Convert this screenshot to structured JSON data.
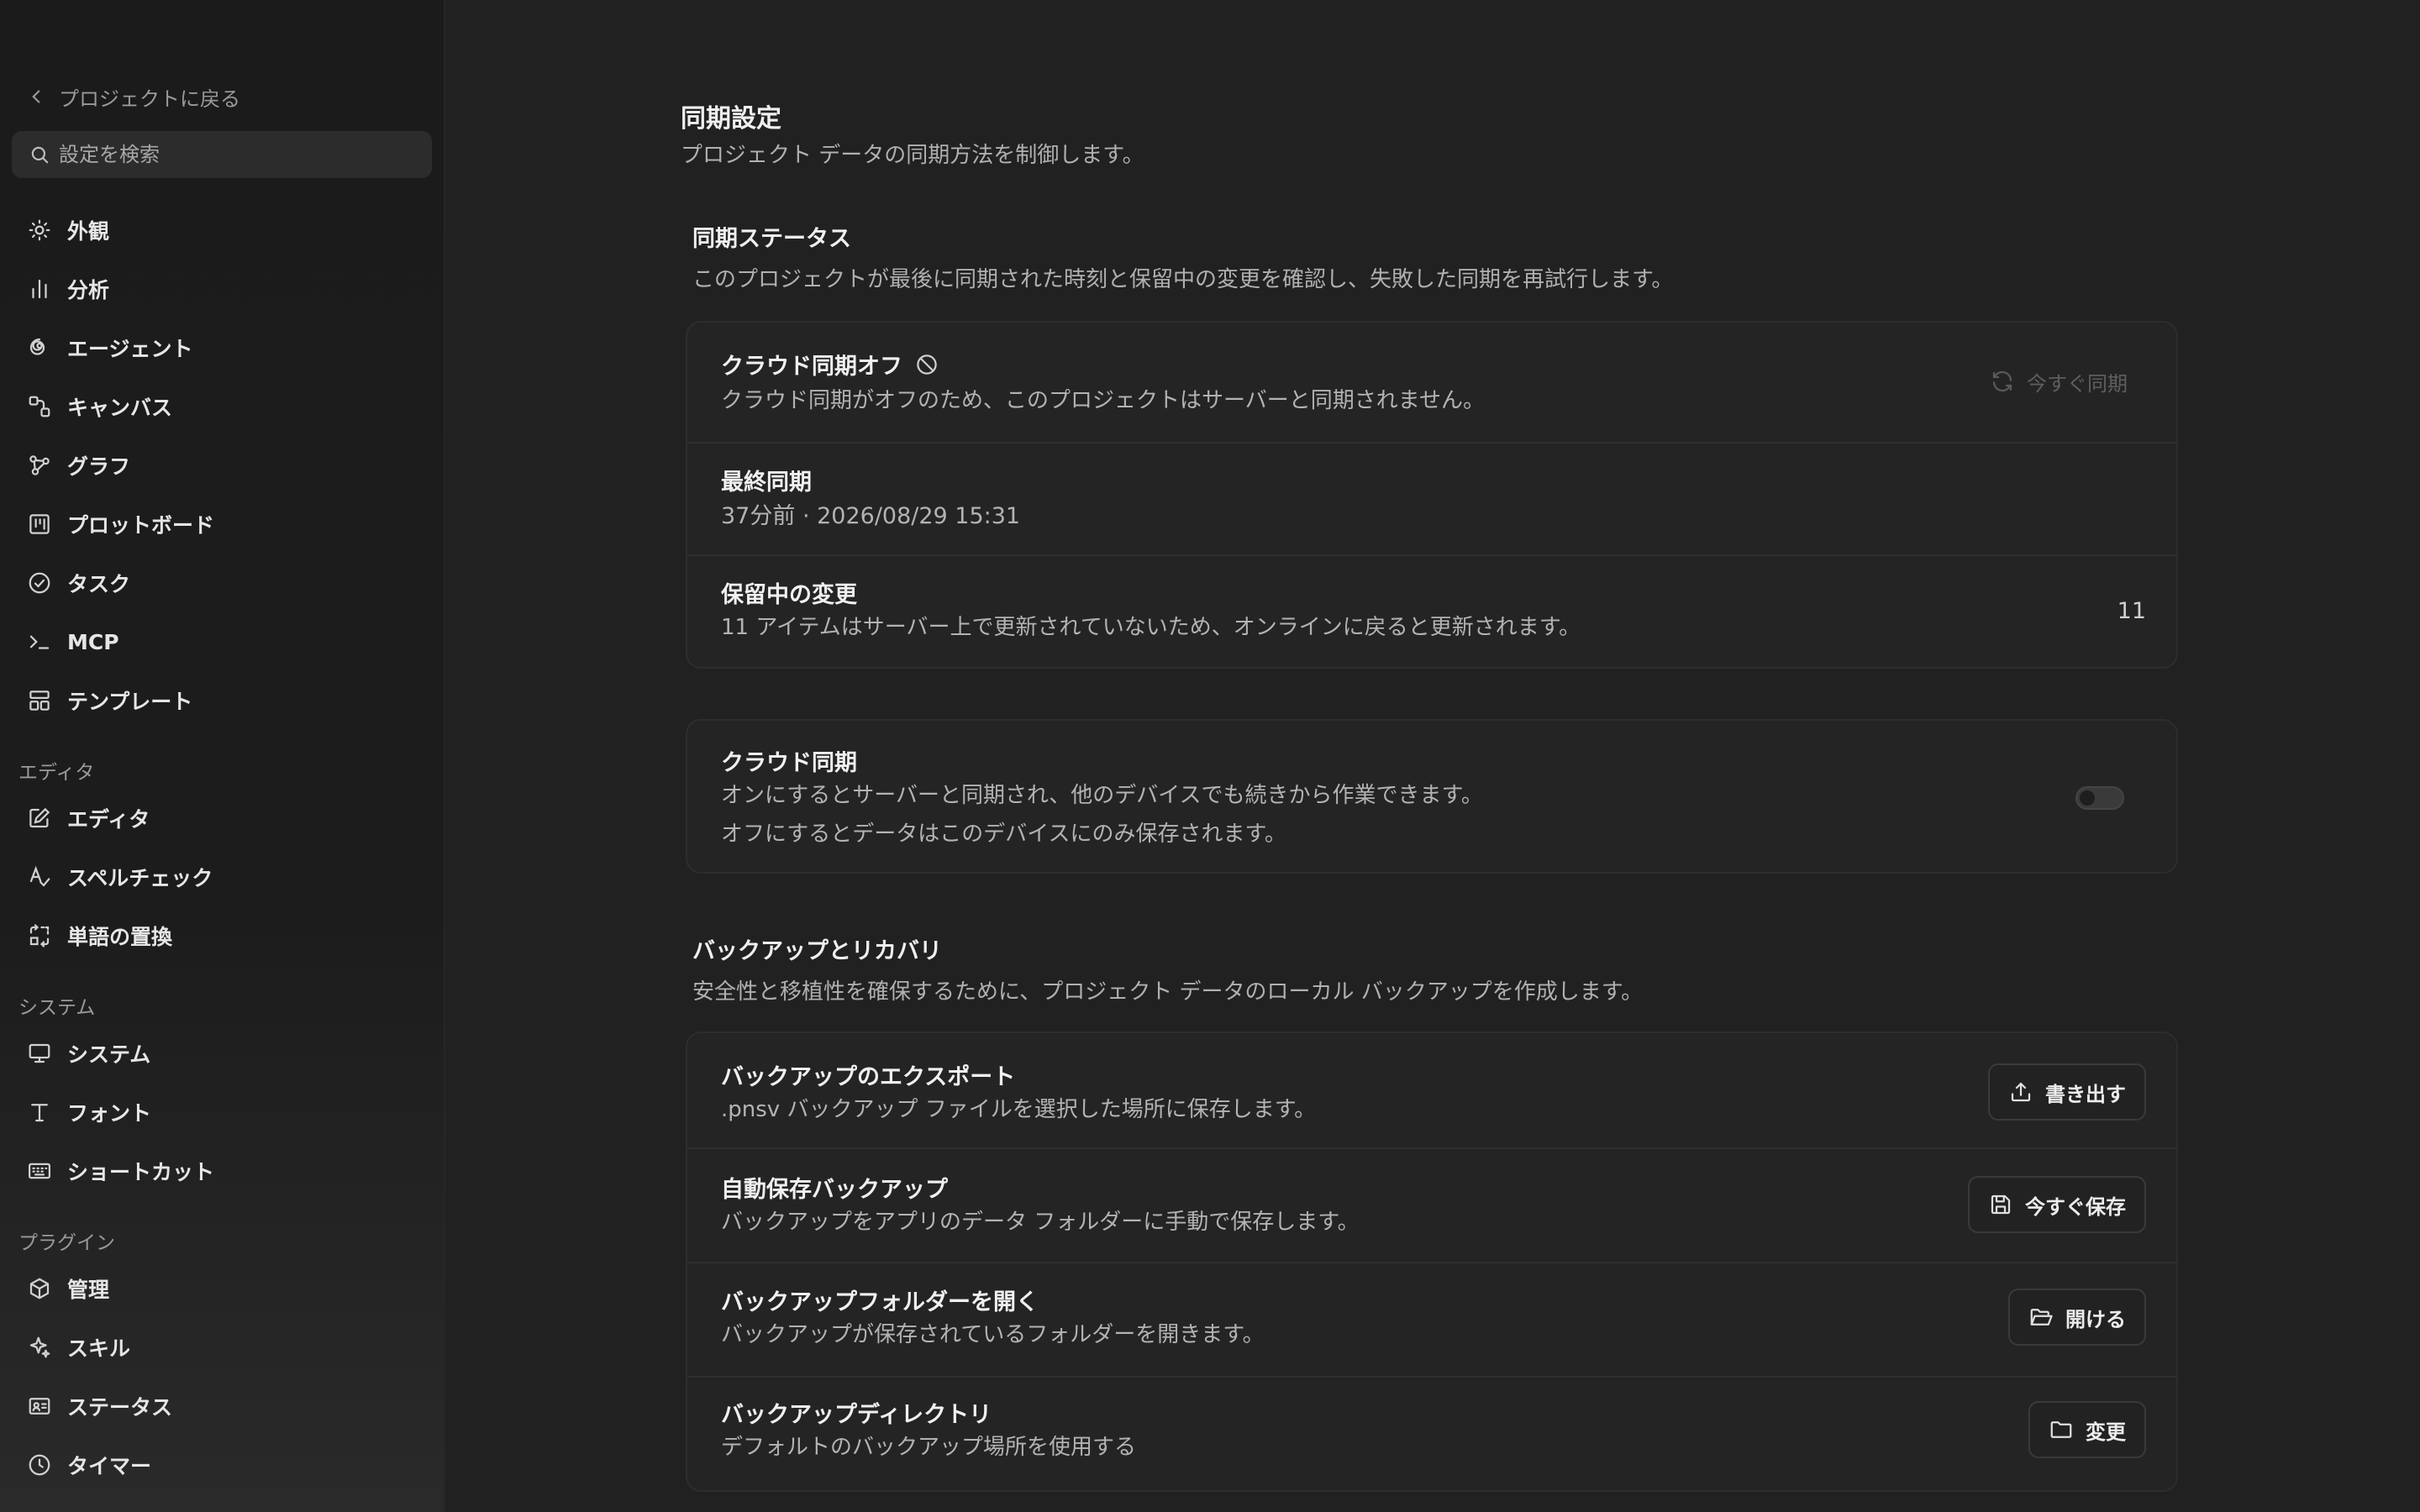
{
  "sidebar": {
    "back_label": "プロジェクトに戻る",
    "search_placeholder": "設定を検索",
    "items": [
      {
        "label": "外観",
        "icon": "sun-icon"
      },
      {
        "label": "分析",
        "icon": "bar-chart-icon"
      },
      {
        "label": "エージェント",
        "icon": "spiral-icon"
      },
      {
        "label": "キャンバス",
        "icon": "canvas-icon"
      },
      {
        "label": "グラフ",
        "icon": "graph-icon"
      },
      {
        "label": "プロットボード",
        "icon": "kanban-icon"
      },
      {
        "label": "タスク",
        "icon": "check-circle-icon"
      },
      {
        "label": "MCP",
        "icon": "terminal-icon"
      },
      {
        "label": "テンプレート",
        "icon": "template-icon"
      }
    ],
    "groups": {
      "editor": {
        "label": "エディタ",
        "items": [
          {
            "label": "エディタ",
            "icon": "edit-icon"
          },
          {
            "label": "スペルチェック",
            "icon": "spellcheck-icon"
          },
          {
            "label": "単語の置換",
            "icon": "replace-icon"
          }
        ]
      },
      "system": {
        "label": "システム",
        "items": [
          {
            "label": "システム",
            "icon": "monitor-icon"
          },
          {
            "label": "フォント",
            "icon": "type-icon"
          },
          {
            "label": "ショートカット",
            "icon": "keyboard-icon"
          }
        ]
      },
      "plugins": {
        "label": "プラグイン",
        "items": [
          {
            "label": "管理",
            "icon": "box-icon"
          },
          {
            "label": "スキル",
            "icon": "sparkle-icon"
          },
          {
            "label": "ステータス",
            "icon": "id-card-icon"
          },
          {
            "label": "タイマー",
            "icon": "clock-icon"
          }
        ]
      }
    }
  },
  "main": {
    "title": "同期設定",
    "subtitle": "プロジェクト データの同期方法を制御します。",
    "sync_status": {
      "title": "同期ステータス",
      "subtitle": "このプロジェクトが最後に同期された時刻と保留中の変更を確認し、失敗した同期を再試行します。",
      "cloud_off": {
        "title": "クラウド同期オフ",
        "desc": "クラウド同期がオフのため、このプロジェクトはサーバーと同期されません。",
        "button": "今すぐ同期"
      },
      "last_sync": {
        "title": "最終同期",
        "desc": "37分前 · 2026/08/29 15:31"
      },
      "pending": {
        "title": "保留中の変更",
        "desc": "11 アイテムはサーバー上で更新されていないため、オンラインに戻ると更新されます。",
        "count": "11"
      }
    },
    "cloud_sync": {
      "title": "クラウド同期",
      "desc1": "オンにするとサーバーと同期され、他のデバイスでも続きから作業できます。",
      "desc2": "オフにするとデータはこのデバイスにのみ保存されます。",
      "enabled": false
    },
    "backup": {
      "title": "バックアップとリカバリ",
      "subtitle": "安全性と移植性を確保するために、プロジェクト データのローカル バックアップを作成します。",
      "rows": [
        {
          "title": "バックアップのエクスポート",
          "desc": ".pnsv バックアップ ファイルを選択した場所に保存します。",
          "button": "書き出す",
          "icon": "upload-icon"
        },
        {
          "title": "自動保存バックアップ",
          "desc": "バックアップをアプリのデータ フォルダーに手動で保存します。",
          "button": "今すぐ保存",
          "icon": "save-icon"
        },
        {
          "title": "バックアップフォルダーを開く",
          "desc": "バックアップが保存されているフォルダーを開きます。",
          "button": "開ける",
          "icon": "folder-open-icon"
        },
        {
          "title": "バックアップディレクトリ",
          "desc": "デフォルトのバックアップ場所を使用する",
          "button": "変更",
          "icon": "folder-icon"
        }
      ]
    }
  }
}
